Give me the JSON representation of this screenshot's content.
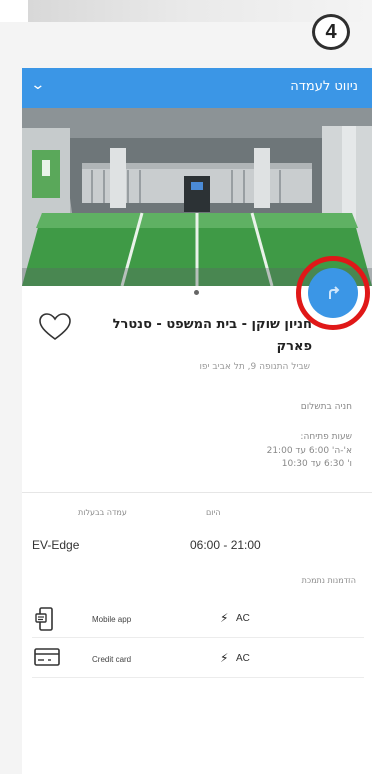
{
  "step_badge": "4",
  "header": {
    "title": "ניווט לעמדה",
    "chevron_icon": "chevron-down-icon"
  },
  "place": {
    "name": "חניון שוקן - בית המשפט - סנטרל פארק",
    "address": "שביל התנופה 9, תל אביב יפו",
    "fee": "חניה בתשלום",
    "hours_title": "שעות פתיחה:",
    "hours": [
      "א'-ה' 6:00 עד 21:00",
      "ו' 6:30 עד 10:30"
    ]
  },
  "station": {
    "owner_label": "עמדה בבעלות",
    "owner_value": "EV-Edge",
    "today_label": "היום",
    "today_value": "06:00 - 21:00"
  },
  "payments": {
    "title": "הזדמנות נתמכת",
    "items": [
      {
        "label": "Mobile app",
        "icon": "mobile-app-icon",
        "connector": "AC"
      },
      {
        "label": "Credit card",
        "icon": "credit-card-icon",
        "connector": "AC"
      }
    ]
  },
  "colors": {
    "accent": "#3b96e6",
    "highlight_ring": "#e01818"
  }
}
